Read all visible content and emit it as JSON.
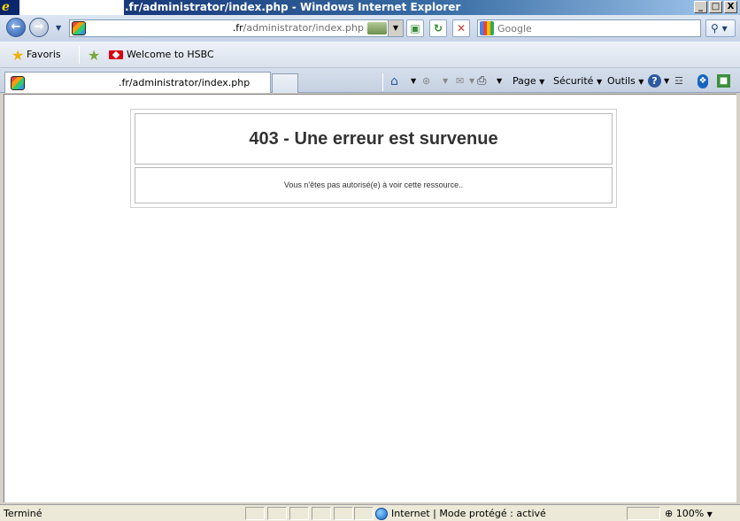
{
  "window": {
    "title": ".fr/administrator/index.php - Windows Internet Explorer",
    "buttons": [
      "_",
      "□",
      "X"
    ]
  },
  "address_bar": {
    "domain": ".fr",
    "path": "/administrator/index.php"
  },
  "search": {
    "placeholder": "Google"
  },
  "favorites": {
    "label": "Favoris",
    "link": "Welcome to HSBC"
  },
  "tab": {
    "label": ".fr/administrator/index.php"
  },
  "command_bar": {
    "page": "Page",
    "security": "Sécurité",
    "tools": "Outils"
  },
  "error": {
    "title": "403 - Une erreur est survenue",
    "message": "Vous n'êtes pas autorisé(e) à voir cette ressource.."
  },
  "status": {
    "text": "Terminé",
    "zone": "Internet | Mode protégé : activé",
    "zoom": "100%"
  },
  "icons": {
    "back": "back-arrow-icon",
    "forward": "forward-arrow-icon",
    "refresh": "refresh-icon",
    "stop": "stop-icon",
    "search": "search-magnifier-icon",
    "home": "home-icon",
    "feeds": "rss-feed-icon",
    "mail": "mail-icon",
    "print": "printer-icon",
    "help": "help-icon"
  }
}
